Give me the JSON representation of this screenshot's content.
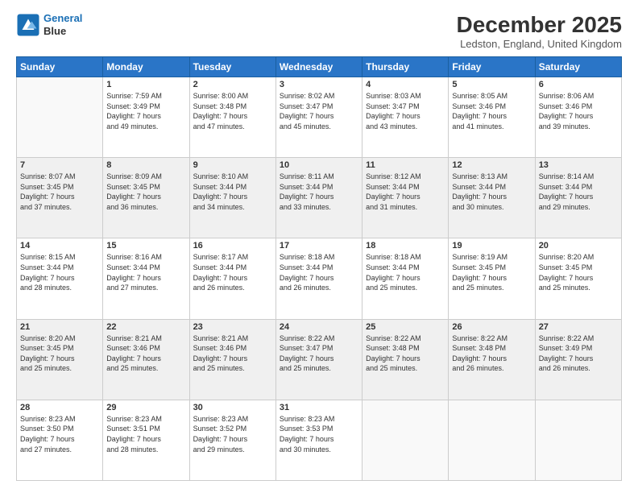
{
  "logo": {
    "line1": "General",
    "line2": "Blue"
  },
  "title": "December 2025",
  "location": "Ledston, England, United Kingdom",
  "days_of_week": [
    "Sunday",
    "Monday",
    "Tuesday",
    "Wednesday",
    "Thursday",
    "Friday",
    "Saturday"
  ],
  "weeks": [
    [
      {
        "day": "",
        "sunrise": "",
        "sunset": "",
        "daylight": ""
      },
      {
        "day": "1",
        "sunrise": "7:59 AM",
        "sunset": "3:49 PM",
        "daylight": "7 hours and 49 minutes."
      },
      {
        "day": "2",
        "sunrise": "8:00 AM",
        "sunset": "3:48 PM",
        "daylight": "7 hours and 47 minutes."
      },
      {
        "day": "3",
        "sunrise": "8:02 AM",
        "sunset": "3:47 PM",
        "daylight": "7 hours and 45 minutes."
      },
      {
        "day": "4",
        "sunrise": "8:03 AM",
        "sunset": "3:47 PM",
        "daylight": "7 hours and 43 minutes."
      },
      {
        "day": "5",
        "sunrise": "8:05 AM",
        "sunset": "3:46 PM",
        "daylight": "7 hours and 41 minutes."
      },
      {
        "day": "6",
        "sunrise": "8:06 AM",
        "sunset": "3:46 PM",
        "daylight": "7 hours and 39 minutes."
      }
    ],
    [
      {
        "day": "7",
        "sunrise": "8:07 AM",
        "sunset": "3:45 PM",
        "daylight": "7 hours and 37 minutes."
      },
      {
        "day": "8",
        "sunrise": "8:09 AM",
        "sunset": "3:45 PM",
        "daylight": "7 hours and 36 minutes."
      },
      {
        "day": "9",
        "sunrise": "8:10 AM",
        "sunset": "3:44 PM",
        "daylight": "7 hours and 34 minutes."
      },
      {
        "day": "10",
        "sunrise": "8:11 AM",
        "sunset": "3:44 PM",
        "daylight": "7 hours and 33 minutes."
      },
      {
        "day": "11",
        "sunrise": "8:12 AM",
        "sunset": "3:44 PM",
        "daylight": "7 hours and 31 minutes."
      },
      {
        "day": "12",
        "sunrise": "8:13 AM",
        "sunset": "3:44 PM",
        "daylight": "7 hours and 30 minutes."
      },
      {
        "day": "13",
        "sunrise": "8:14 AM",
        "sunset": "3:44 PM",
        "daylight": "7 hours and 29 minutes."
      }
    ],
    [
      {
        "day": "14",
        "sunrise": "8:15 AM",
        "sunset": "3:44 PM",
        "daylight": "7 hours and 28 minutes."
      },
      {
        "day": "15",
        "sunrise": "8:16 AM",
        "sunset": "3:44 PM",
        "daylight": "7 hours and 27 minutes."
      },
      {
        "day": "16",
        "sunrise": "8:17 AM",
        "sunset": "3:44 PM",
        "daylight": "7 hours and 26 minutes."
      },
      {
        "day": "17",
        "sunrise": "8:18 AM",
        "sunset": "3:44 PM",
        "daylight": "7 hours and 26 minutes."
      },
      {
        "day": "18",
        "sunrise": "8:18 AM",
        "sunset": "3:44 PM",
        "daylight": "7 hours and 25 minutes."
      },
      {
        "day": "19",
        "sunrise": "8:19 AM",
        "sunset": "3:45 PM",
        "daylight": "7 hours and 25 minutes."
      },
      {
        "day": "20",
        "sunrise": "8:20 AM",
        "sunset": "3:45 PM",
        "daylight": "7 hours and 25 minutes."
      }
    ],
    [
      {
        "day": "21",
        "sunrise": "8:20 AM",
        "sunset": "3:45 PM",
        "daylight": "7 hours and 25 minutes."
      },
      {
        "day": "22",
        "sunrise": "8:21 AM",
        "sunset": "3:46 PM",
        "daylight": "7 hours and 25 minutes."
      },
      {
        "day": "23",
        "sunrise": "8:21 AM",
        "sunset": "3:46 PM",
        "daylight": "7 hours and 25 minutes."
      },
      {
        "day": "24",
        "sunrise": "8:22 AM",
        "sunset": "3:47 PM",
        "daylight": "7 hours and 25 minutes."
      },
      {
        "day": "25",
        "sunrise": "8:22 AM",
        "sunset": "3:48 PM",
        "daylight": "7 hours and 25 minutes."
      },
      {
        "day": "26",
        "sunrise": "8:22 AM",
        "sunset": "3:48 PM",
        "daylight": "7 hours and 26 minutes."
      },
      {
        "day": "27",
        "sunrise": "8:22 AM",
        "sunset": "3:49 PM",
        "daylight": "7 hours and 26 minutes."
      }
    ],
    [
      {
        "day": "28",
        "sunrise": "8:23 AM",
        "sunset": "3:50 PM",
        "daylight": "7 hours and 27 minutes."
      },
      {
        "day": "29",
        "sunrise": "8:23 AM",
        "sunset": "3:51 PM",
        "daylight": "7 hours and 28 minutes."
      },
      {
        "day": "30",
        "sunrise": "8:23 AM",
        "sunset": "3:52 PM",
        "daylight": "7 hours and 29 minutes."
      },
      {
        "day": "31",
        "sunrise": "8:23 AM",
        "sunset": "3:53 PM",
        "daylight": "7 hours and 30 minutes."
      },
      {
        "day": "",
        "sunrise": "",
        "sunset": "",
        "daylight": ""
      },
      {
        "day": "",
        "sunrise": "",
        "sunset": "",
        "daylight": ""
      },
      {
        "day": "",
        "sunrise": "",
        "sunset": "",
        "daylight": ""
      }
    ]
  ],
  "labels": {
    "sunrise": "Sunrise: ",
    "sunset": "Sunset: ",
    "daylight": "Daylight: "
  }
}
